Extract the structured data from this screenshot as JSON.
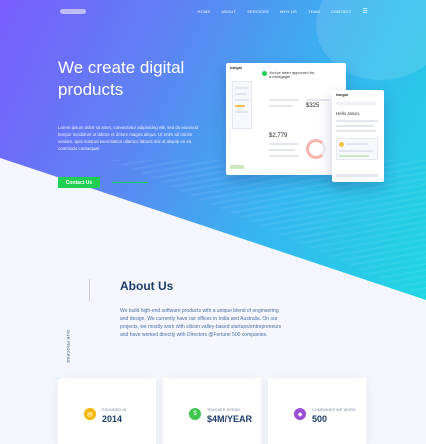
{
  "nav": {
    "items": [
      "HOME",
      "ABOUT",
      "SERVICES",
      "WHY US",
      "TEAM",
      "CONTACT"
    ],
    "menu_icon": "hamburger-icon"
  },
  "hero": {
    "title_line1": "We create digital",
    "title_line2": "products",
    "text": "Lorem ipsum dolor sit amet, consectetur adipisicing elit, sed do eiusmod tempor incididunt ut labore et dolore magna aliqua. Ut enim ad minim veniam, quis nostrud exercitation ullamco laboris nisi ut aliquip ex ea commodo consequat.",
    "cta_label": "Contact Us",
    "accent": "#1fcf52"
  },
  "mockup": {
    "brand": "hangat",
    "headline": "You've been approved for a mortgage!",
    "value_a": "$2,779",
    "value_b": "$325",
    "phone_brand": "hangat",
    "phone_greeting": "Hello Jason,"
  },
  "about": {
    "title": "About Us",
    "side_label": "OUR PROCESS",
    "text": "We build high-end software products with a unique blend of engineering and design. We currently have our offices in India and Australia. On our projects, we mostly work with silicon valley-based startups/entrepreneurs and have worked directly with Directors @Fortune 500 companies."
  },
  "stats": [
    {
      "label": "FOUNDED IN",
      "value": "2014",
      "icon": "calendar-icon",
      "color": "#f7b500"
    },
    {
      "label": "TRACKED SPEND",
      "value": "$4M/YEAR",
      "icon": "money-icon",
      "color": "#3fc64f"
    },
    {
      "label": "COMPANIES WE WORK",
      "value": "500",
      "icon": "building-icon",
      "color": "#9b4fd9"
    }
  ]
}
